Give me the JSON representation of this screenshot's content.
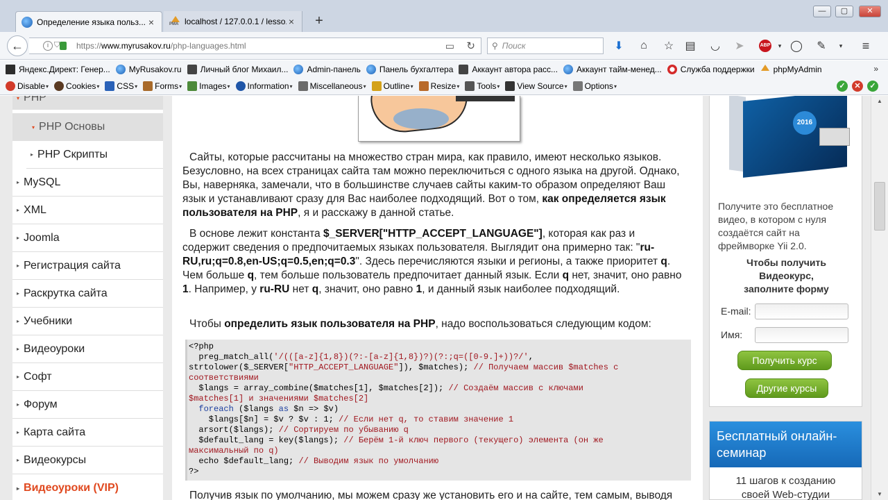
{
  "browser": {
    "tabs": [
      {
        "title": "Определение языка польз..."
      },
      {
        "title": "localhost / 127.0.0.1 / lesso..."
      }
    ],
    "url": {
      "scheme": "https://",
      "host": "www.myrusakov.ru",
      "path": "/php-languages.html"
    },
    "search_placeholder": "Поиск",
    "abp_label": "ABP"
  },
  "bookmarks": [
    {
      "label": "Яндекс.Директ: Генер...",
      "icon": "page-icon"
    },
    {
      "label": "MyRusakov.ru",
      "icon": "globe-icon"
    },
    {
      "label": "Личный блог Михаил...",
      "icon": "page-icon"
    },
    {
      "label": "Admin-панель",
      "icon": "globe-icon"
    },
    {
      "label": "Панель бухгалтера",
      "icon": "globe-icon"
    },
    {
      "label": "Аккаунт автора расс...",
      "icon": "page-icon"
    },
    {
      "label": "Аккаунт тайм-менед...",
      "icon": "globe-icon"
    },
    {
      "label": "Служба поддержки",
      "icon": "support-icon"
    },
    {
      "label": "phpMyAdmin",
      "icon": "pma-icon"
    }
  ],
  "webdev_toolbar": [
    {
      "label": "Disable",
      "color": "#d23b2b"
    },
    {
      "label": "Cookies",
      "color": "#5a3a22"
    },
    {
      "label": "CSS",
      "color": "#2a62b8"
    },
    {
      "label": "Forms",
      "color": "#a86a2a"
    },
    {
      "label": "Images",
      "color": "#4d8a3a"
    },
    {
      "label": "Information",
      "color": "#1f56a8"
    },
    {
      "label": "Miscellaneous",
      "color": "#6b6b6b"
    },
    {
      "label": "Outline",
      "color": "#d4a21a"
    },
    {
      "label": "Resize",
      "color": "#b86a2a"
    },
    {
      "label": "Tools",
      "color": "#555555"
    },
    {
      "label": "View Source",
      "color": "#333333"
    },
    {
      "label": "Options",
      "color": "#777777"
    }
  ],
  "sidebar": {
    "items": [
      {
        "label": "PHP",
        "type": "active-top"
      },
      {
        "label": "PHP Основы",
        "type": "sub-active"
      },
      {
        "label": "PHP Скрипты",
        "type": "sub"
      },
      {
        "label": "MySQL",
        "type": "item"
      },
      {
        "label": "XML",
        "type": "item"
      },
      {
        "label": "Joomla",
        "type": "item"
      },
      {
        "label": "Регистрация сайта",
        "type": "item"
      },
      {
        "label": "Раскрутка сайта",
        "type": "item"
      },
      {
        "label": "Учебники",
        "type": "item"
      },
      {
        "label": "Видеоуроки",
        "type": "item"
      },
      {
        "label": "Софт",
        "type": "item"
      },
      {
        "label": "Форум",
        "type": "item"
      },
      {
        "label": "Карта сайта",
        "type": "item"
      },
      {
        "label": "Видеокурсы",
        "type": "item"
      },
      {
        "label": "Видеоуроки (VIP)",
        "type": "vip"
      }
    ]
  },
  "article": {
    "p1_indent": " ",
    "p1_a": "Сайты, которые рассчитаны на множество стран мира, как правило, имеют несколько языков. Безусловно, на всех страницах сайта там можно переключиться с одного языка на другой. Однако, Вы, наверняка, замечали, что в большинстве случаев сайты каким-то образом определяют Ваш язык и устанавливают сразу для Вас наиболее подходящий. Вот о том, ",
    "p1_b": "как определяется язык пользователя на PHP",
    "p1_c": ", я и расскажу в данной статье.",
    "p2_a": "В основе лежит константа ",
    "p2_b": "$_SERVER[\"HTTP_ACCEPT_LANGUAGE\"]",
    "p2_c": ", которая как раз и содержит сведения о предпочитаемых языках пользователя. Выглядит она примерно так: \"",
    "p2_d": "ru-RU,ru;q=0.8,en-US;q=0.5,en;q=0.3",
    "p2_e": "\". Здесь перечисляются языки и регионы, а также приоритет ",
    "p2_f": "q",
    "p2_g": ". Чем больше ",
    "p2_h": "q",
    "p2_i": ", тем больше пользователь предпочитает данный язык. Если ",
    "p2_j": "q",
    "p2_k": " нет, значит, оно равно ",
    "p2_l": "1",
    "p2_m": ". Например, у ",
    "p2_n": "ru-RU",
    "p2_o": " нет ",
    "p2_p": "q",
    "p2_q": ", значит, оно равно ",
    "p2_r": "1",
    "p2_s": ", и данный язык наиболее подходящий.",
    "p3_a": "Чтобы ",
    "p3_b": "определить язык пользователя на PHP",
    "p3_c": ", надо воспользоваться следующим кодом:",
    "p4": "Получив язык по умолчанию, мы можем сразу же установить его и на сайте, тем самым, выводя"
  },
  "code_lines": [
    {
      "segments": [
        {
          "t": "<?php",
          "c": "fn"
        }
      ]
    },
    {
      "segments": [
        {
          "t": "  preg_match_all(",
          "c": "fn"
        },
        {
          "t": "'/(([a-z]{1,8})(?:-[a-z]{1,8})?)(?:;q=([0-9.]+))?/'",
          "c": "st"
        },
        {
          "t": ",",
          "c": "fn"
        }
      ]
    },
    {
      "segments": [
        {
          "t": "strtolower($_SERVER[",
          "c": "fn"
        },
        {
          "t": "\"HTTP_ACCEPT_LANGUAGE\"",
          "c": "st"
        },
        {
          "t": "]), $matches); ",
          "c": "fn"
        },
        {
          "t": "// Получаем массив $matches с",
          "c": "cm"
        }
      ]
    },
    {
      "segments": [
        {
          "t": "соответствиями",
          "c": "cm"
        }
      ]
    },
    {
      "segments": [
        {
          "t": "  $langs = array_combine($matches[1], $matches[2]); ",
          "c": "fn"
        },
        {
          "t": "// Создаём массив с ключами",
          "c": "cm"
        }
      ]
    },
    {
      "segments": [
        {
          "t": "$matches[1] и значениями $matches[2]",
          "c": "cm"
        }
      ]
    },
    {
      "segments": [
        {
          "t": "  ",
          "c": "fn"
        },
        {
          "t": "foreach",
          "c": "kw"
        },
        {
          "t": " ($langs ",
          "c": "fn"
        },
        {
          "t": "as",
          "c": "kw"
        },
        {
          "t": " $n => $v)",
          "c": "fn"
        }
      ]
    },
    {
      "segments": [
        {
          "t": "    $langs[$n] = $v ? $v : 1; ",
          "c": "fn"
        },
        {
          "t": "// Если нет q, то ставим значение 1",
          "c": "cm"
        }
      ]
    },
    {
      "segments": [
        {
          "t": "  arsort($langs); ",
          "c": "fn"
        },
        {
          "t": "// Сортируем по убыванию q",
          "c": "cm"
        }
      ]
    },
    {
      "segments": [
        {
          "t": "  $default_lang = key($langs); ",
          "c": "fn"
        },
        {
          "t": "// Берём 1-й ключ первого (текущего) элемента (он же",
          "c": "cm"
        }
      ]
    },
    {
      "segments": [
        {
          "t": "максимальный по q)",
          "c": "cm"
        }
      ]
    },
    {
      "segments": [
        {
          "t": "  echo $default_lang; ",
          "c": "fn"
        },
        {
          "t": "// Выводим язык по умолчанию",
          "c": "cm"
        }
      ]
    },
    {
      "segments": [
        {
          "t": "?>",
          "c": "fn"
        }
      ]
    }
  ],
  "right_panel": {
    "badge_year": "2016",
    "description": "Получите это бесплатное видео, в котором с нуля создаётся сайт на фреймворке Yii 2.0.",
    "cta_line1": "Чтобы получить",
    "cta_line2": "Видеокурс,",
    "cta_line3": "заполните форму",
    "email_label": "E-mail:",
    "name_label": "Имя:",
    "get_course_button": "Получить курс",
    "other_courses_button": "Другие курсы"
  },
  "seminar": {
    "title": "Бесплатный онлайн-семинар",
    "subtitle_partial": "11 шагов к созданию",
    "subtitle_cut": "своей Web-студии"
  }
}
